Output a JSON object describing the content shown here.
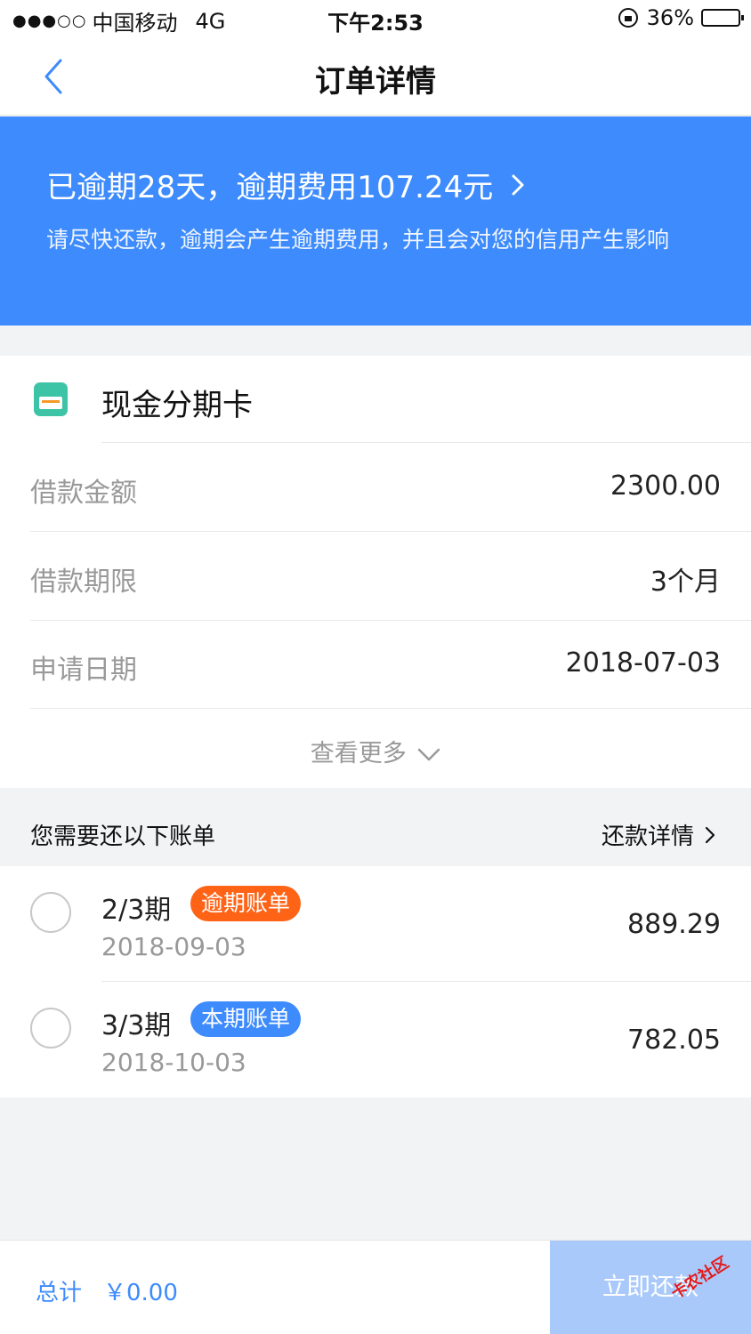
{
  "status_bar": {
    "signal": "●●●○○",
    "carrier": "中国移动",
    "network": "4G",
    "time": "下午2:53",
    "battery": "36%",
    "battery_level": 0.36
  },
  "nav": {
    "title": "订单详情"
  },
  "banner": {
    "headline": "已逾期28天，逾期费用107.24元",
    "description": "请尽快还款，逾期会产生逾期费用，并且会对您的信用产生影响",
    "color": "#3d8bfd"
  },
  "product": {
    "name": "现金分期卡",
    "icon": "credit-card-icon"
  },
  "details": [
    {
      "label": "借款金额",
      "value": "2300.00"
    },
    {
      "label": "借款期限",
      "value": "3个月"
    },
    {
      "label": "申请日期",
      "value": "2018-07-03"
    }
  ],
  "more_label": "查看更多",
  "bills_section": {
    "title": "您需要还以下账单",
    "link": "还款详情"
  },
  "bills": [
    {
      "period": "2/3期",
      "tag": "逾期账单",
      "date": "2018-09-03",
      "amount": "889.29",
      "tag_color": "#ff6316"
    },
    {
      "period": "3/3期",
      "tag": "本期账单",
      "date": "2018-10-03",
      "amount": "782.05",
      "tag_color": "#3d8bfd"
    }
  ],
  "footer": {
    "total_label": "总计",
    "total_value": "￥0.00",
    "pay_button": "立即还款"
  },
  "watermark": "卡农社区"
}
